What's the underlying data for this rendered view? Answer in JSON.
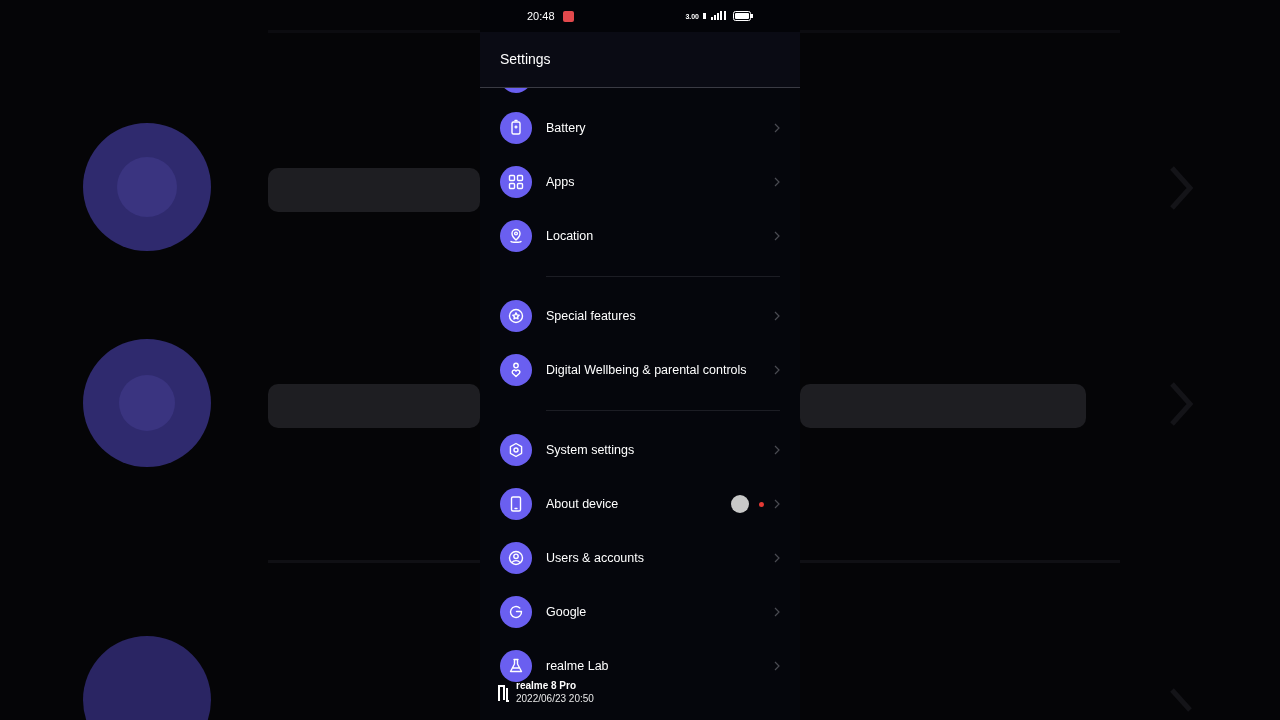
{
  "status_bar": {
    "time": "20:48",
    "net_speed": "3.00"
  },
  "header": {
    "title": "Settings"
  },
  "groups": [
    {
      "items": [
        {
          "kind": "battery",
          "label": "Battery",
          "badge": false,
          "touched": false
        },
        {
          "kind": "apps",
          "label": "Apps",
          "badge": false,
          "touched": false
        },
        {
          "kind": "location",
          "label": "Location",
          "badge": false,
          "touched": false
        }
      ]
    },
    {
      "items": [
        {
          "kind": "star",
          "label": "Special features",
          "badge": false,
          "touched": false
        },
        {
          "kind": "wellbeing",
          "label": "Digital Wellbeing & parental controls",
          "badge": false,
          "touched": false
        }
      ]
    },
    {
      "items": [
        {
          "kind": "system",
          "label": "System settings",
          "badge": false,
          "touched": false
        },
        {
          "kind": "device",
          "label": "About device",
          "badge": true,
          "touched": true
        },
        {
          "kind": "users",
          "label": "Users & accounts",
          "badge": false,
          "touched": false
        },
        {
          "kind": "google",
          "label": "Google",
          "badge": false,
          "touched": false
        },
        {
          "kind": "lab",
          "label": "realme Lab",
          "badge": false,
          "touched": false
        }
      ]
    }
  ],
  "watermark": {
    "device": "realme 8 Pro",
    "timestamp": "2022/06/23 20:50"
  }
}
